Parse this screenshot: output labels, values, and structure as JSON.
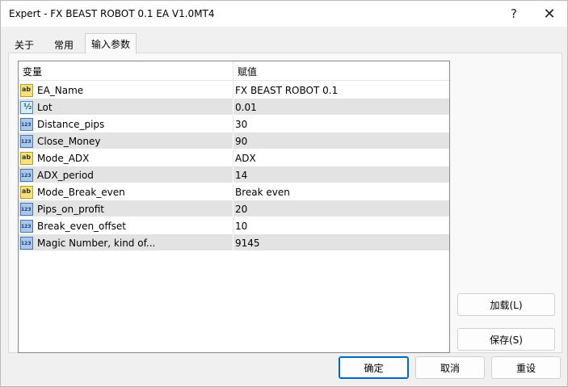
{
  "window": {
    "title": "Expert - FX BEAST ROBOT 0.1 EA V1.0MT4",
    "help_glyph": "?",
    "close_glyph": "✕"
  },
  "tabs": [
    {
      "label": "关于"
    },
    {
      "label": "常用"
    },
    {
      "label": "输入参数",
      "active": true
    }
  ],
  "grid": {
    "columns": [
      "变量",
      "赋值"
    ],
    "rows": [
      {
        "icon": "string-type-icon",
        "name": "EA_Name",
        "value": "FX BEAST ROBOT 0.1"
      },
      {
        "icon": "double-type-icon",
        "name": "Lot",
        "value": "0.01"
      },
      {
        "icon": "integer-type-icon",
        "name": "Distance_pips",
        "value": "30"
      },
      {
        "icon": "integer-type-icon",
        "name": "Close_Money",
        "value": "90"
      },
      {
        "icon": "string-type-icon",
        "name": "Mode_ADX",
        "value": "ADX"
      },
      {
        "icon": "integer-type-icon",
        "name": "ADX_period",
        "value": "14"
      },
      {
        "icon": "string-type-icon",
        "name": "Mode_Break_even",
        "value": "Break even"
      },
      {
        "icon": "integer-type-icon",
        "name": "Pips_on_profit",
        "value": "20"
      },
      {
        "icon": "integer-type-icon",
        "name": "Break_even_offset",
        "value": "10"
      },
      {
        "icon": "integer-type-icon",
        "name": "Magic Number, kind of...",
        "value": "9145"
      }
    ]
  },
  "buttons": {
    "load": "加载(L)",
    "save": "保存(S)",
    "ok": "确定",
    "cancel": "取消",
    "reset": "重设"
  },
  "colors": {
    "accent": "#0067c0",
    "alt_row": "#e3e3e3",
    "string_icon": "#f5e37a",
    "number_icon": "#a9c8ea"
  }
}
